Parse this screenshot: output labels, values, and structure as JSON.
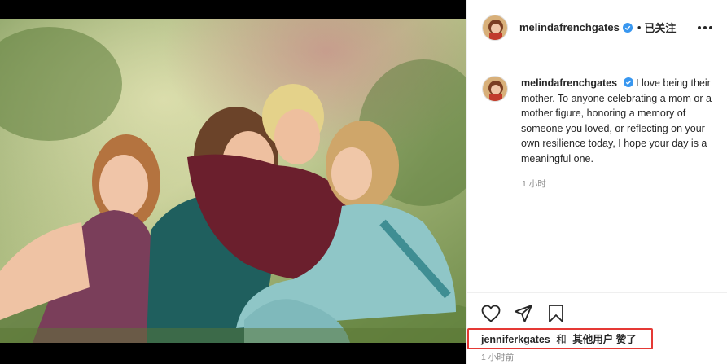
{
  "post": {
    "username": "melindafrenchgates",
    "separator": "•",
    "follow_state": "已关注",
    "caption_username": "melindafrenchgates",
    "caption": "I love being their mother. To anyone celebrating a mom or a mother figure, honoring a memory of someone you loved, or reflecting on your own resilience today, I hope your day is a meaningful one.",
    "caption_time": "1 小时",
    "likes": {
      "first_user": "jenniferkgates",
      "and_word": "和",
      "others": "其他用户",
      "liked": "赞了"
    },
    "post_time": "1 小时前"
  },
  "icons": {
    "verified": "verified-badge-icon",
    "more": "more-options-icon",
    "like": "heart-icon",
    "share": "share-plane-icon",
    "save": "bookmark-icon"
  },
  "colors": {
    "verified_blue": "#3897f0",
    "highlight_red": "#e53935",
    "muted_text": "#8e8e8e"
  }
}
